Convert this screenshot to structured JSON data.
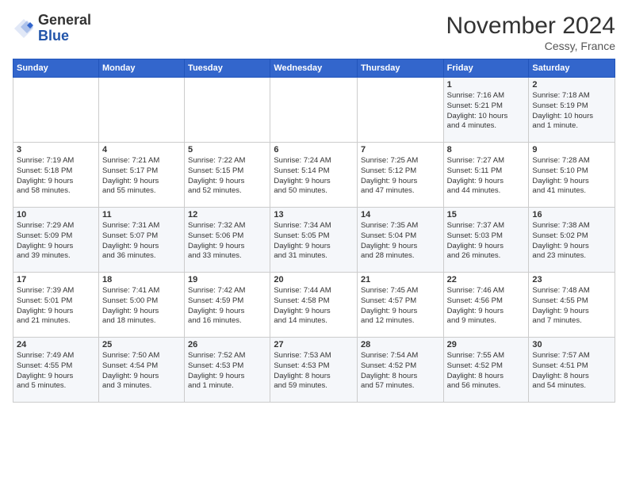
{
  "logo": {
    "general": "General",
    "blue": "Blue"
  },
  "header": {
    "month_year": "November 2024",
    "location": "Cessy, France"
  },
  "weekdays": [
    "Sunday",
    "Monday",
    "Tuesday",
    "Wednesday",
    "Thursday",
    "Friday",
    "Saturday"
  ],
  "weeks": [
    [
      {
        "day": "",
        "info": ""
      },
      {
        "day": "",
        "info": ""
      },
      {
        "day": "",
        "info": ""
      },
      {
        "day": "",
        "info": ""
      },
      {
        "day": "",
        "info": ""
      },
      {
        "day": "1",
        "info": "Sunrise: 7:16 AM\nSunset: 5:21 PM\nDaylight: 10 hours\nand 4 minutes."
      },
      {
        "day": "2",
        "info": "Sunrise: 7:18 AM\nSunset: 5:19 PM\nDaylight: 10 hours\nand 1 minute."
      }
    ],
    [
      {
        "day": "3",
        "info": "Sunrise: 7:19 AM\nSunset: 5:18 PM\nDaylight: 9 hours\nand 58 minutes."
      },
      {
        "day": "4",
        "info": "Sunrise: 7:21 AM\nSunset: 5:17 PM\nDaylight: 9 hours\nand 55 minutes."
      },
      {
        "day": "5",
        "info": "Sunrise: 7:22 AM\nSunset: 5:15 PM\nDaylight: 9 hours\nand 52 minutes."
      },
      {
        "day": "6",
        "info": "Sunrise: 7:24 AM\nSunset: 5:14 PM\nDaylight: 9 hours\nand 50 minutes."
      },
      {
        "day": "7",
        "info": "Sunrise: 7:25 AM\nSunset: 5:12 PM\nDaylight: 9 hours\nand 47 minutes."
      },
      {
        "day": "8",
        "info": "Sunrise: 7:27 AM\nSunset: 5:11 PM\nDaylight: 9 hours\nand 44 minutes."
      },
      {
        "day": "9",
        "info": "Sunrise: 7:28 AM\nSunset: 5:10 PM\nDaylight: 9 hours\nand 41 minutes."
      }
    ],
    [
      {
        "day": "10",
        "info": "Sunrise: 7:29 AM\nSunset: 5:09 PM\nDaylight: 9 hours\nand 39 minutes."
      },
      {
        "day": "11",
        "info": "Sunrise: 7:31 AM\nSunset: 5:07 PM\nDaylight: 9 hours\nand 36 minutes."
      },
      {
        "day": "12",
        "info": "Sunrise: 7:32 AM\nSunset: 5:06 PM\nDaylight: 9 hours\nand 33 minutes."
      },
      {
        "day": "13",
        "info": "Sunrise: 7:34 AM\nSunset: 5:05 PM\nDaylight: 9 hours\nand 31 minutes."
      },
      {
        "day": "14",
        "info": "Sunrise: 7:35 AM\nSunset: 5:04 PM\nDaylight: 9 hours\nand 28 minutes."
      },
      {
        "day": "15",
        "info": "Sunrise: 7:37 AM\nSunset: 5:03 PM\nDaylight: 9 hours\nand 26 minutes."
      },
      {
        "day": "16",
        "info": "Sunrise: 7:38 AM\nSunset: 5:02 PM\nDaylight: 9 hours\nand 23 minutes."
      }
    ],
    [
      {
        "day": "17",
        "info": "Sunrise: 7:39 AM\nSunset: 5:01 PM\nDaylight: 9 hours\nand 21 minutes."
      },
      {
        "day": "18",
        "info": "Sunrise: 7:41 AM\nSunset: 5:00 PM\nDaylight: 9 hours\nand 18 minutes."
      },
      {
        "day": "19",
        "info": "Sunrise: 7:42 AM\nSunset: 4:59 PM\nDaylight: 9 hours\nand 16 minutes."
      },
      {
        "day": "20",
        "info": "Sunrise: 7:44 AM\nSunset: 4:58 PM\nDaylight: 9 hours\nand 14 minutes."
      },
      {
        "day": "21",
        "info": "Sunrise: 7:45 AM\nSunset: 4:57 PM\nDaylight: 9 hours\nand 12 minutes."
      },
      {
        "day": "22",
        "info": "Sunrise: 7:46 AM\nSunset: 4:56 PM\nDaylight: 9 hours\nand 9 minutes."
      },
      {
        "day": "23",
        "info": "Sunrise: 7:48 AM\nSunset: 4:55 PM\nDaylight: 9 hours\nand 7 minutes."
      }
    ],
    [
      {
        "day": "24",
        "info": "Sunrise: 7:49 AM\nSunset: 4:55 PM\nDaylight: 9 hours\nand 5 minutes."
      },
      {
        "day": "25",
        "info": "Sunrise: 7:50 AM\nSunset: 4:54 PM\nDaylight: 9 hours\nand 3 minutes."
      },
      {
        "day": "26",
        "info": "Sunrise: 7:52 AM\nSunset: 4:53 PM\nDaylight: 9 hours\nand 1 minute."
      },
      {
        "day": "27",
        "info": "Sunrise: 7:53 AM\nSunset: 4:53 PM\nDaylight: 8 hours\nand 59 minutes."
      },
      {
        "day": "28",
        "info": "Sunrise: 7:54 AM\nSunset: 4:52 PM\nDaylight: 8 hours\nand 57 minutes."
      },
      {
        "day": "29",
        "info": "Sunrise: 7:55 AM\nSunset: 4:52 PM\nDaylight: 8 hours\nand 56 minutes."
      },
      {
        "day": "30",
        "info": "Sunrise: 7:57 AM\nSunset: 4:51 PM\nDaylight: 8 hours\nand 54 minutes."
      }
    ]
  ]
}
